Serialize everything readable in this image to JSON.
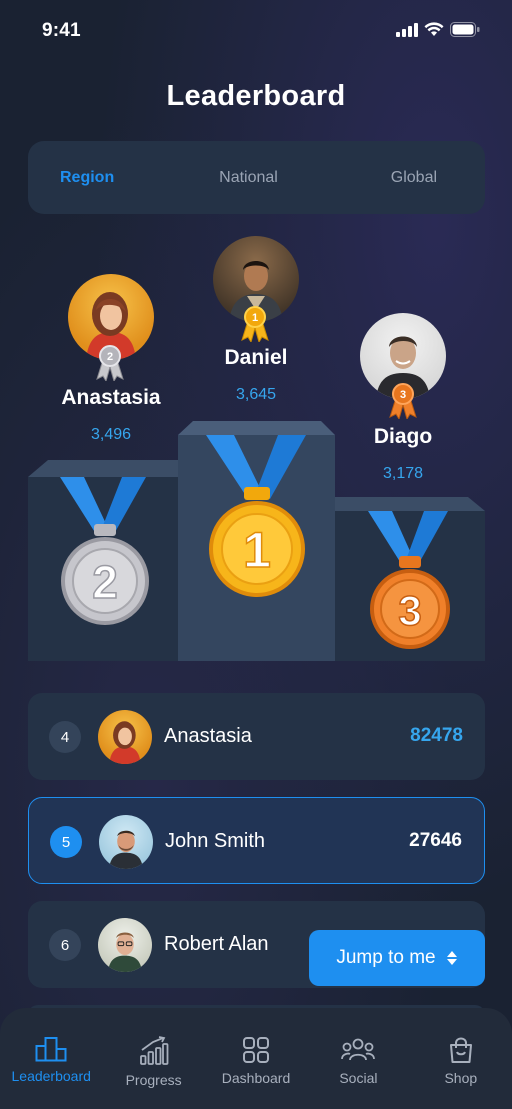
{
  "status": {
    "time": "9:41"
  },
  "title": "Leaderboard",
  "tabs": [
    {
      "label": "Region",
      "active": true
    },
    {
      "label": "National",
      "active": false
    },
    {
      "label": "Global",
      "active": false
    }
  ],
  "podium": {
    "first": {
      "name": "Daniel",
      "score": "3,645",
      "rank": "1"
    },
    "second": {
      "name": "Anastasia",
      "score": "3,496",
      "rank": "2"
    },
    "third": {
      "name": "Diago",
      "score": "3,178",
      "rank": "3"
    },
    "medal_labels": [
      "2",
      "1",
      "3"
    ]
  },
  "list": [
    {
      "rank": "4",
      "name": "Anastasia",
      "score": "82478",
      "score_color": "#36a6ee",
      "highlight": false
    },
    {
      "rank": "5",
      "name": "John Smith",
      "score": "27646",
      "score_color": "#ffffff",
      "highlight": true
    },
    {
      "rank": "6",
      "name": "Robert Alan",
      "score": "",
      "score_color": "#ffffff",
      "highlight": false
    }
  ],
  "jump_button": {
    "label": "Jump to me"
  },
  "nav": [
    {
      "label": "Leaderboard",
      "icon": "podium-icon",
      "active": true
    },
    {
      "label": "Progress",
      "icon": "bar-chart-icon",
      "active": false
    },
    {
      "label": "Dashboard",
      "icon": "grid-icon",
      "active": false
    },
    {
      "label": "Social",
      "icon": "group-icon",
      "active": false
    },
    {
      "label": "Shop",
      "icon": "shopping-bag-icon",
      "active": false
    }
  ],
  "colors": {
    "accent": "#1e8ff0",
    "gold": "#f7b51a",
    "silver": "#c8c8cc",
    "bronze": "#f0802a",
    "score_blue": "#36a6ee"
  }
}
